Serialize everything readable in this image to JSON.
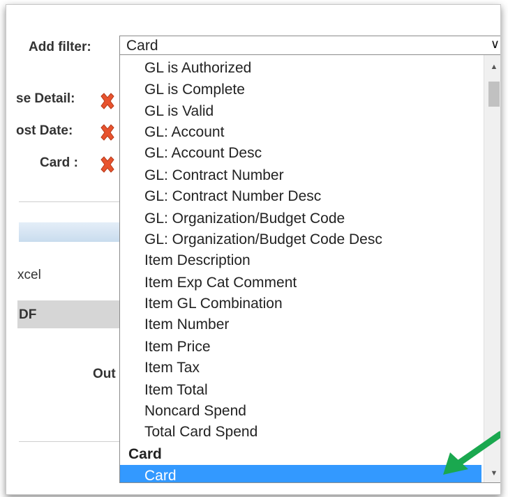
{
  "filter": {
    "label": "Add filter:",
    "selected": "Card",
    "options": [
      "GL is Authorized",
      "GL is Complete",
      "GL is Valid",
      "GL: Account",
      "GL: Account Desc",
      "GL: Contract Number",
      "GL: Contract Number Desc",
      "GL: Organization/Budget Code",
      "GL: Organization/Budget Code Desc",
      "Item Description",
      "Item Exp Cat Comment",
      "Item GL Combination",
      "Item Number",
      "Item Price",
      "Item Tax",
      "Item Total",
      "Noncard Spend",
      "Total Card Spend"
    ],
    "group_label": "Card",
    "highlighted_option": "Card"
  },
  "background": {
    "rows": [
      "se Detail:",
      "ost Date:",
      "Card :"
    ],
    "export_excel": "xcel",
    "export_pdf": "DF",
    "output_label": "Out"
  },
  "colors": {
    "highlight": "#3399ff",
    "arrow": "#1aa84f",
    "remove_icon": "#e8532e"
  },
  "icons": {
    "remove": "remove-x-icon",
    "dropdown": "chevron-down-icon",
    "scroll_up": "scroll-up-arrow-icon",
    "scroll_down": "scroll-down-arrow-icon",
    "pointer": "green-arrow-icon"
  }
}
